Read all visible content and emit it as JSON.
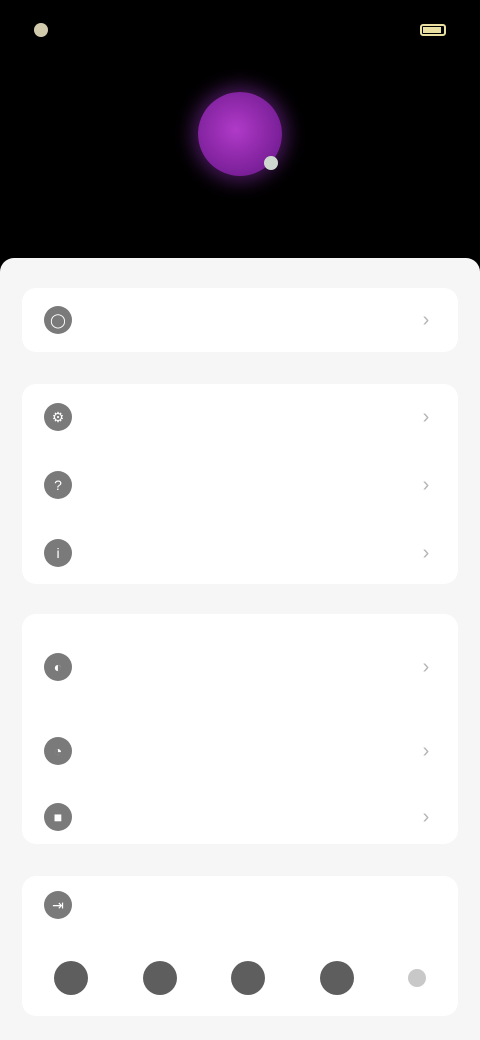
{
  "status": {
    "time": "",
    "battery_level": 0.8
  },
  "header": {
    "avatar_initial": "",
    "email": ""
  },
  "menu": {
    "group1": [
      {
        "label": "",
        "icon": "profile-icon"
      }
    ],
    "group2": [
      {
        "label": "",
        "icon": "settings-icon"
      },
      {
        "label": "",
        "icon": "help-icon"
      },
      {
        "label": "",
        "icon": "about-icon"
      }
    ],
    "group3": [
      {
        "label": "",
        "sub": "",
        "icon": "account-icon"
      },
      {
        "label": "",
        "icon": "privacy-icon"
      },
      {
        "label": "",
        "icon": "security-icon"
      }
    ],
    "group4": [
      {
        "label": "",
        "icon": "logout-icon"
      }
    ]
  },
  "bottom_nav": [
    "home-icon",
    "search-icon",
    "notifications-icon",
    "profile-nav-icon",
    "more-icon"
  ]
}
